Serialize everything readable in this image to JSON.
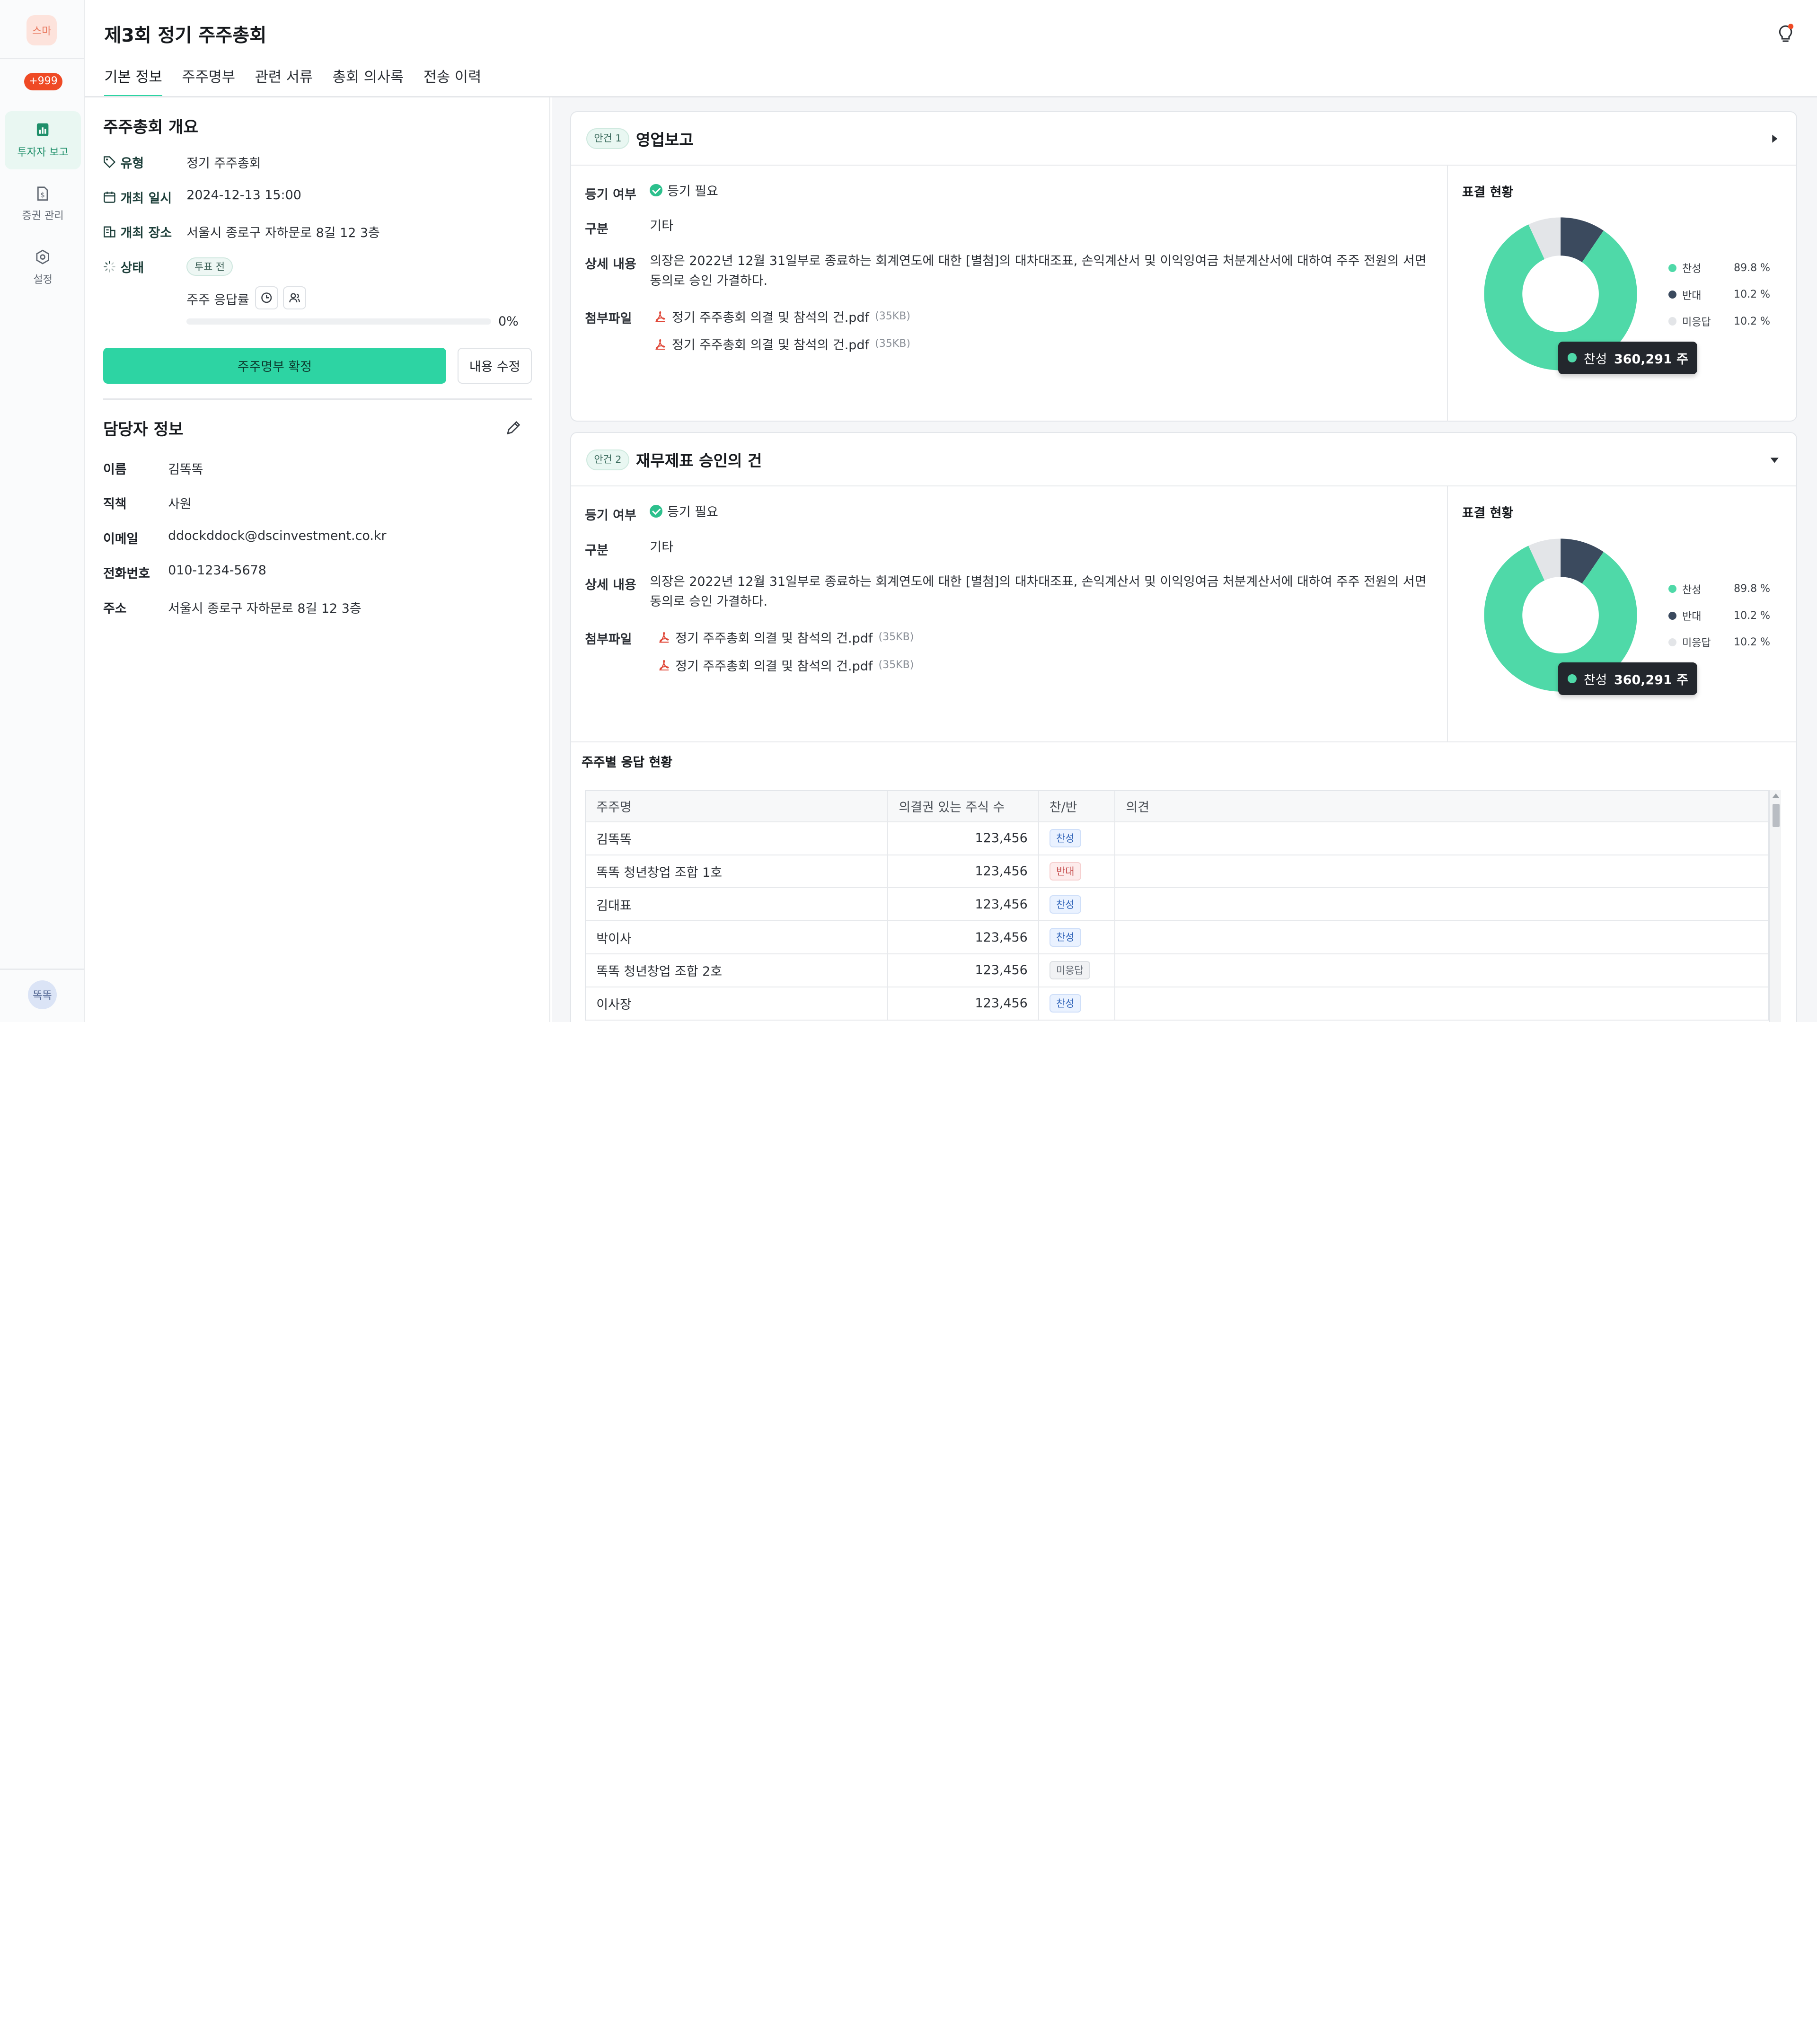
{
  "sidebar": {
    "avatar": "스마",
    "badge": "+999",
    "items": [
      {
        "label": "투자자 보고",
        "icon": "report-icon"
      },
      {
        "label": "증권 관리",
        "icon": "document-icon"
      },
      {
        "label": "설정",
        "icon": "gear-icon"
      }
    ],
    "user": "똑똑"
  },
  "header": {
    "title": "제3회 정기 주주총회",
    "tabs": [
      "기본 정보",
      "주주명부",
      "관련 서류",
      "총회 의사록",
      "전송 이력"
    ],
    "active_tab": 0
  },
  "overview": {
    "title": "주주총회 개요",
    "type_label": "유형",
    "type_value": "정기 주주총회",
    "date_label": "개최 일시",
    "date_value": "2024-12-13 15:00",
    "place_label": "개최 장소",
    "place_value": "서울시 종로구 자하문로 8길 12 3층",
    "status_label": "상태",
    "status_value": "투표 전",
    "response_label": "주주 응답률",
    "response_rate": 0,
    "response_rate_text": "0%",
    "confirm_button": "주주명부 확정",
    "edit_button": "내용 수정"
  },
  "contact": {
    "title": "담당자 정보",
    "fields": [
      {
        "label": "이름",
        "value": "김똑똑"
      },
      {
        "label": "직책",
        "value": "사원"
      },
      {
        "label": "이메일",
        "value": "ddockddock@dscinvestment.co.kr"
      },
      {
        "label": "전화번호",
        "value": "010-1234-5678"
      },
      {
        "label": "주소",
        "value": "서울시 종로구 자하문로 8길 12 3층"
      }
    ]
  },
  "agendas": [
    {
      "tag": "안건 1",
      "title": "영업보고",
      "reg_label": "등기 여부",
      "reg_value": "등기 필요",
      "cat_label": "구분",
      "cat_value": "기타",
      "detail_label": "상세 내용",
      "detail_line1": "의장은 2022년 12월 31일부로 종료하는 회계연도에 대한 [별첨]의 대차대조표, 손익계산서 및 이익잉여금 처분계산서에 대하여 주주 전원의 서면",
      "detail_line2": "동의로 승인 가결하다.",
      "files_label": "첨부파일",
      "files": [
        {
          "name": "정기 주주총회 의결 및 참석의 건.pdf",
          "size": "(35KB)"
        },
        {
          "name": "정기 주주총회 의결 및 참석의 건.pdf",
          "size": "(35KB)"
        }
      ],
      "vote_title": "표결 현황",
      "tooltip_label": "찬성",
      "tooltip_value": "360,291 주"
    },
    {
      "tag": "안건 2",
      "title": "재무제표 승인의 건",
      "reg_label": "등기 여부",
      "reg_value": "등기 필요",
      "cat_label": "구분",
      "cat_value": "기타",
      "detail_label": "상세 내용",
      "detail_line1": "의장은 2022년 12월 31일부로 종료하는 회계연도에 대한 [별첨]의 대차대조표, 손익계산서 및 이익잉여금 처분계산서에 대하여 주주 전원의 서면",
      "detail_line2": "동의로 승인 가결하다.",
      "files_label": "첨부파일",
      "files": [
        {
          "name": "정기 주주총회 의결 및 참석의 건.pdf",
          "size": "(35KB)"
        },
        {
          "name": "정기 주주총회 의결 및 참석의 건.pdf",
          "size": "(35KB)"
        }
      ],
      "vote_title": "표결 현황",
      "tooltip_label": "찬성",
      "tooltip_value": "360,291 주"
    }
  ],
  "vote_legend": [
    {
      "label": "찬성",
      "pct": "89.8 %",
      "color": "#4fd9a8"
    },
    {
      "label": "반대",
      "pct": "10.2 %",
      "color": "#3b4a5e"
    },
    {
      "label": "미응답",
      "pct": "10.2 %",
      "color": "#e3e5e8"
    }
  ],
  "donut_shares": [
    0.836,
    0.095,
    0.069
  ],
  "responses": {
    "title": "주주별 응답 현황",
    "columns": [
      "주주명",
      "의결권 있는 주식 수",
      "찬/반",
      "의견"
    ],
    "rows": [
      {
        "name": "김똑똑",
        "shares": "123,456",
        "vote": "찬성",
        "kind": "yes"
      },
      {
        "name": "똑똑 청년창업 조합 1호",
        "shares": "123,456",
        "vote": "반대",
        "kind": "no"
      },
      {
        "name": "김대표",
        "shares": "123,456",
        "vote": "찬성",
        "kind": "yes"
      },
      {
        "name": "박이사",
        "shares": "123,456",
        "vote": "찬성",
        "kind": "yes"
      },
      {
        "name": "똑똑 청년창업 조합 2호",
        "shares": "123,456",
        "vote": "미응답",
        "kind": "none"
      },
      {
        "name": "이사장",
        "shares": "123,456",
        "vote": "찬성",
        "kind": "yes"
      }
    ]
  }
}
